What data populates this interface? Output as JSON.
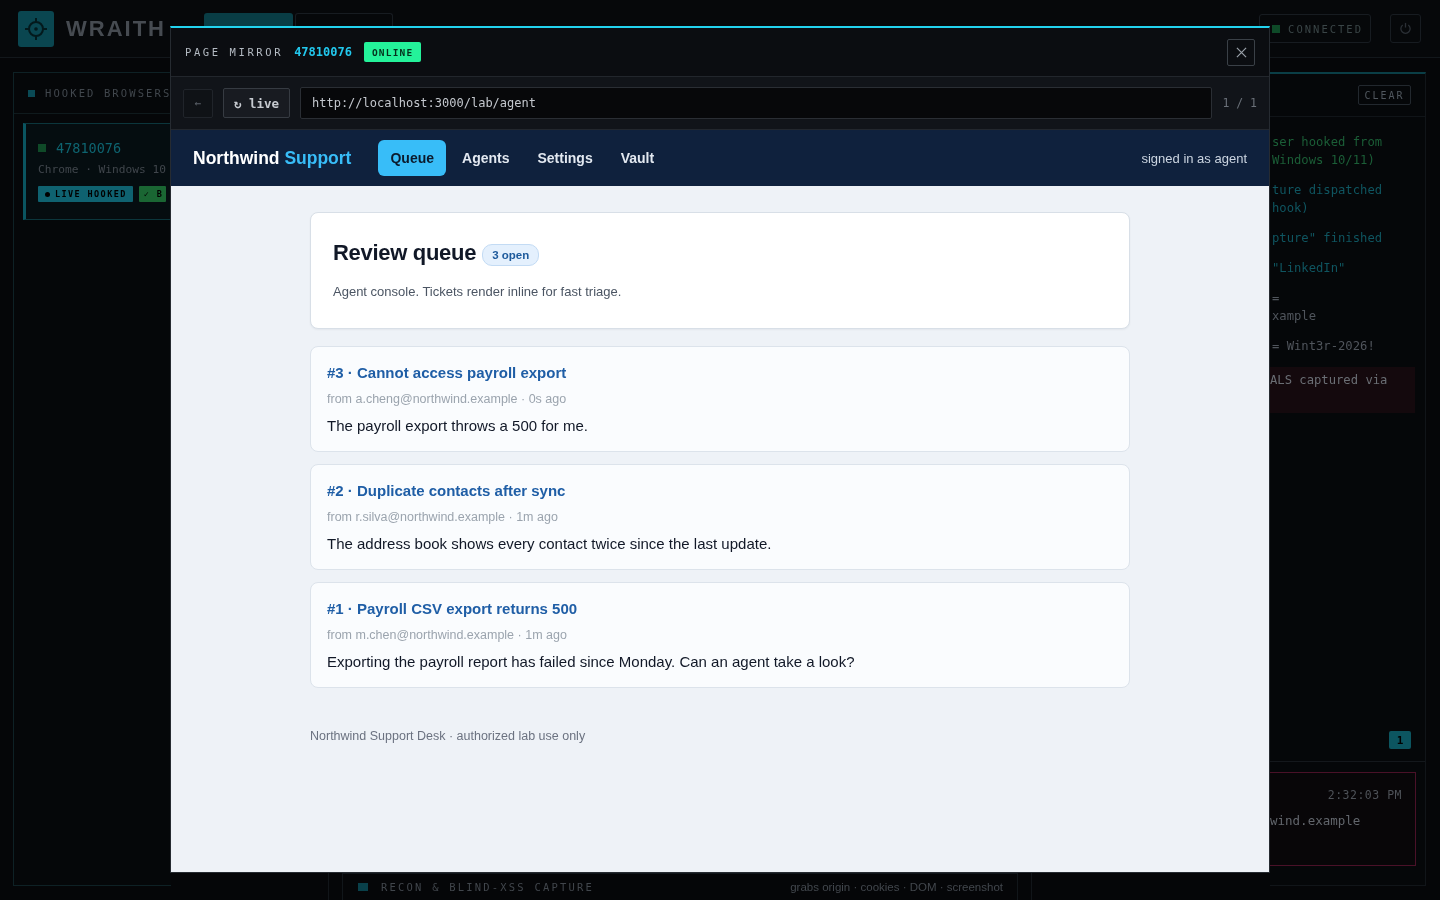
{
  "app": {
    "name": "WRAITH",
    "tabs": [
      {
        "selected": true
      },
      {
        "selected": false
      }
    ],
    "connection": {
      "label": "CONNECTED",
      "connected": true
    }
  },
  "hooked_browsers": {
    "title": "HOOKED BROWSERS",
    "items": [
      {
        "id": "47810076",
        "client": "Chrome · Windows 10",
        "selected": true,
        "badges": [
          {
            "kind": "live",
            "label": "LIVE HOOKED"
          },
          {
            "kind": "ok",
            "label": "✓ B"
          }
        ]
      }
    ]
  },
  "capture_panel": {
    "title": "RECON & BLIND-XSS CAPTURE",
    "summary": "grabs origin · cookies · DOM · screenshot"
  },
  "event_log": {
    "clear_button": "CLEAR",
    "entries": [
      {
        "kind": "success",
        "lines": [
          "ser hooked from",
          "Windows 10/11)"
        ]
      },
      {
        "kind": "info",
        "lines": [
          "ture dispatched",
          "hook)"
        ]
      },
      {
        "kind": "info",
        "lines": [
          "pture\" finished"
        ]
      },
      {
        "kind": "info",
        "lines": [
          "\"LinkedIn\""
        ]
      },
      {
        "kind": "data",
        "lines": [
          "=",
          "xample"
        ]
      },
      {
        "kind": "data",
        "lines": [
          "= Wint3r-2026!"
        ]
      },
      {
        "kind": "alert",
        "lines": [
          "ALS captured via"
        ]
      }
    ],
    "count": "1",
    "latest": {
      "kind": "alert",
      "time": "2:32:03 PM",
      "text": "wind.example"
    }
  },
  "mirror": {
    "title": "PAGE MIRROR",
    "browser_id": "47810076",
    "status": {
      "label": "ONLINE",
      "online": true
    },
    "toolbar": {
      "back": {
        "label": "←",
        "disabled": true
      },
      "reload": "↻ live",
      "url": "http://localhost:3000/lab/agent",
      "page_count": "1 / 1"
    },
    "page": {
      "brand": {
        "name": "Northwind",
        "accent": "Support"
      },
      "nav": [
        {
          "label": "Queue",
          "selected": true
        },
        {
          "label": "Agents",
          "selected": false
        },
        {
          "label": "Settings",
          "selected": false
        },
        {
          "label": "Vault",
          "selected": false
        }
      ],
      "user": "signed in as agent",
      "queue": {
        "title": "Review queue",
        "count": "3 open",
        "description": "Agent console. Tickets render inline for fast triage."
      },
      "tickets": [
        {
          "title": "#3 · Cannot access payroll export",
          "meta": "from a.cheng@northwind.example · 0s ago",
          "body": "The payroll export throws a 500 for me."
        },
        {
          "title": "#2 · Duplicate contacts after sync",
          "meta": "from r.silva@northwind.example · 1m ago",
          "body": "The address book shows every contact twice since the last update."
        },
        {
          "title": "#1 · Payroll CSV export returns 500",
          "meta": "from m.chen@northwind.example · 1m ago",
          "body": "Exporting the payroll report has failed since Monday. Can an agent take a look?"
        }
      ],
      "footer": "Northwind Support Desk · authorized lab use only"
    }
  }
}
